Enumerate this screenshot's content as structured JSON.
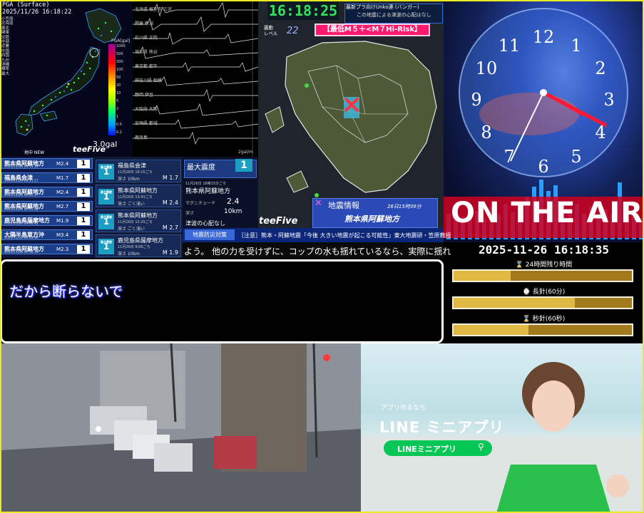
{
  "pga": {
    "header_line1": "PGA (Surface)",
    "header_line2": "2025/11/26 16:18:22",
    "stations": [
      "小笠原",
      "北海道",
      "東北",
      "関東",
      "北陸",
      "中部",
      "近畿",
      "中国",
      "四国",
      "九州",
      "沖縄",
      "標準",
      "最大"
    ],
    "unit_label": "PGA[gal]",
    "scale": [
      "1000",
      "500",
      "200",
      "100",
      "50",
      "20",
      "10",
      "5",
      "2",
      "1",
      "0.5",
      "0.2"
    ],
    "max_value": "3.0gal"
  },
  "waveforms": {
    "labels": [
      "北海道 根室市 三沢",
      "関東 新潟",
      "石川県 正院",
      "埼玉県 熊谷",
      "東京都 都市",
      "神奈川県 相模",
      "静岡 伊豆",
      "大阪府 大阪",
      "宮崎県 都城",
      "鹿児島"
    ],
    "unit": "2gal/m"
  },
  "intensity_list": {
    "header": "地中 NEW",
    "brand": "teeFive",
    "rows": [
      {
        "place": "熊本県阿蘇地方",
        "date": "2025/11/26 16:15:19",
        "mag": "M2.4",
        "intensity": "1"
      },
      {
        "place": "福島県会津",
        "date": "2025/11/26 16:15:17",
        "mag": "M1.7",
        "intensity": "1"
      },
      {
        "place": "熊本県阿蘇地方",
        "date": "2025/11/26 13:41:37",
        "mag": "M2.4",
        "intensity": "1"
      },
      {
        "place": "熊本県阿蘇地方",
        "date": "2025/11/26 12:25:08",
        "mag": "M2.7",
        "intensity": "1"
      },
      {
        "place": "鹿児島県薩摩地方",
        "date": "2025/11/26 09:06:44",
        "mag": "M1.9",
        "intensity": "1"
      },
      {
        "place": "大隅半島東方沖",
        "date": "2025/11/26 06:56:02",
        "mag": "M3.4",
        "intensity": "1"
      },
      {
        "place": "熊本県阿蘇地方",
        "date": "2025/11/26 01:58:39",
        "mag": "M2.3",
        "intensity": "1"
      }
    ]
  },
  "quake_cards": [
    {
      "intensity": "1",
      "label": "最大震度",
      "place": "福島県会津",
      "time": "11月26日 16:15ごろ",
      "depth": "深さ 10km",
      "mag": "M 1.7"
    },
    {
      "intensity": "1",
      "label": "最大震度",
      "place": "熊本県阿蘇地方",
      "time": "11月26日 13:41ごろ",
      "depth": "深さ ごく浅い",
      "mag": "M 2.4"
    },
    {
      "intensity": "1",
      "label": "最大震度",
      "place": "熊本県阿蘇地方",
      "time": "11月26日 12:25ごろ",
      "depth": "深さ ごく浅い",
      "mag": "M 2.7"
    },
    {
      "intensity": "1",
      "label": "最大震度",
      "place": "鹿児島県薩摩地方",
      "time": "11月26日 9:06ごろ",
      "depth": "深さ 10km",
      "mag": "M 1.9"
    }
  ],
  "max_panel": {
    "title": "最大震度",
    "value": "1",
    "time": "11月26日 16時15分ごろ",
    "place": "熊本県阿蘇地方",
    "mag_label": "マグニチュード",
    "mag_value": "2.4",
    "depth_label": "深さ",
    "depth_value": "10km",
    "tsunami": "津波の心配なし"
  },
  "kyushu": {
    "clock": "16:18:25",
    "title_line1": "最新プラ向けUnko連 (バンガー)",
    "title_line2": "この地震による津波の心配はなし",
    "level_label": "震動\nレベル",
    "level_value": "22",
    "risk_label": "【最低M５＋<M７Hi-Risk】",
    "info_title": "地震情報",
    "info_time": "26日15時39分",
    "info_place": "熊本県阿蘇地方",
    "brand": "teeFive"
  },
  "clock": {
    "numbers": [
      "12",
      "1",
      "2",
      "3",
      "4",
      "5",
      "6",
      "7",
      "8",
      "9",
      "10",
      "11"
    ],
    "on_air": "ON THE AIR",
    "digital": "2025-11-26 16:18:35"
  },
  "countdown": [
    {
      "label": "⌛ 24時間残り時間",
      "fill": 0.32
    },
    {
      "label": "⌚ 長針(60分)",
      "fill": 0.68
    },
    {
      "label": "⌛ 秒針(60秒)",
      "fill": 0.42
    }
  ],
  "ticker": {
    "tag": "地震防災対策",
    "top": "［注意］熊本・阿蘇地震「今後 大きい地震が起こる可能性」東大地震研・笠原教授",
    "bottom": "よう。 他の力を受けずに、コップの水も揺れているなら、実際に揺れ"
  },
  "subtitle": {
    "text": "だから断らないで"
  },
  "ad": {
    "small": "アプリ作るなら",
    "brand": "LINE ミニアプリ",
    "button": "LINEミニアプリ"
  },
  "colors": {
    "on_air": "#d0001e",
    "line_green": "#06c755",
    "border": "#e8ea24"
  }
}
